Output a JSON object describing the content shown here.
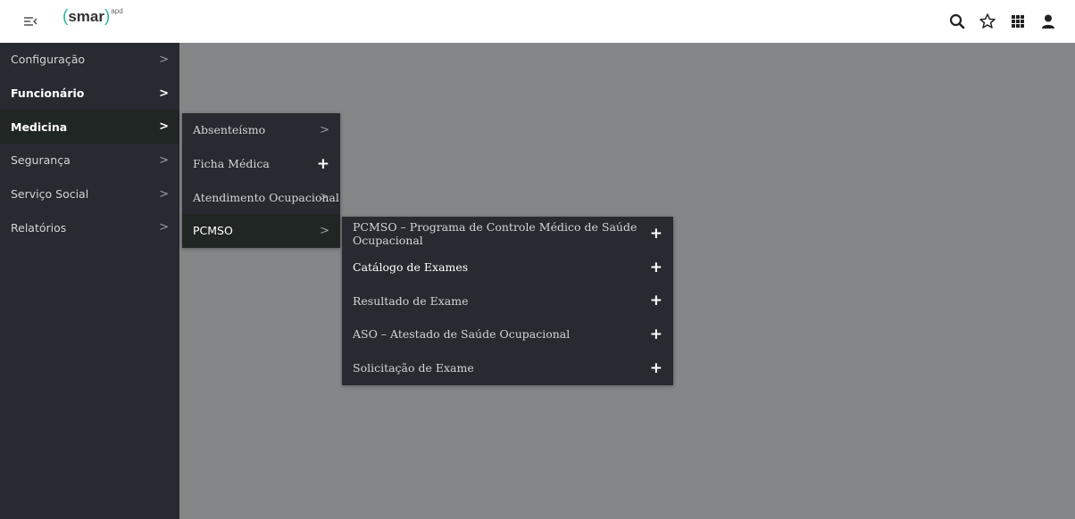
{
  "brand": {
    "logo_open": "(",
    "logo_text": "smar",
    "logo_close": ")",
    "logo_sup": "apd"
  },
  "icons": [
    "menu-collapse-icon",
    "search-icon",
    "star-icon",
    "apps-grid-icon",
    "user-icon"
  ],
  "colors": {
    "topbar": "#ffffff",
    "sidebar": "#272a30",
    "active_bg": "#1f2624",
    "backdrop": "#858688",
    "accent": "#2bb3a3"
  },
  "sidebar": {
    "items": [
      {
        "label": "Configuração",
        "chevron": ">"
      },
      {
        "label": "Funcionário",
        "chevron": ">"
      },
      {
        "label": "Medicina",
        "chevron": ">"
      },
      {
        "label": "Segurança",
        "chevron": ">"
      },
      {
        "label": "Serviço Social",
        "chevron": ">"
      },
      {
        "label": "Relatórios",
        "chevron": ">"
      }
    ]
  },
  "medicina_menu": {
    "items": [
      {
        "label": "Absenteísmo",
        "marker": ">"
      },
      {
        "label": "Ficha Médica",
        "marker": "+"
      },
      {
        "label": "Atendimento Ocupacional",
        "marker": ">"
      },
      {
        "label": "PCMSO",
        "marker": ">"
      }
    ]
  },
  "pcmso_menu": {
    "items": [
      {
        "label": "PCMSO – Programa de Controle Médico de Saúde Ocupacional",
        "marker": "+"
      },
      {
        "label": "Catálogo de Exames",
        "marker": "+"
      },
      {
        "label": "Resultado de Exame",
        "marker": "+"
      },
      {
        "label": "ASO – Atestado de Saúde Ocupacional",
        "marker": "+"
      },
      {
        "label": "Solicitação de Exame",
        "marker": "+"
      }
    ]
  }
}
